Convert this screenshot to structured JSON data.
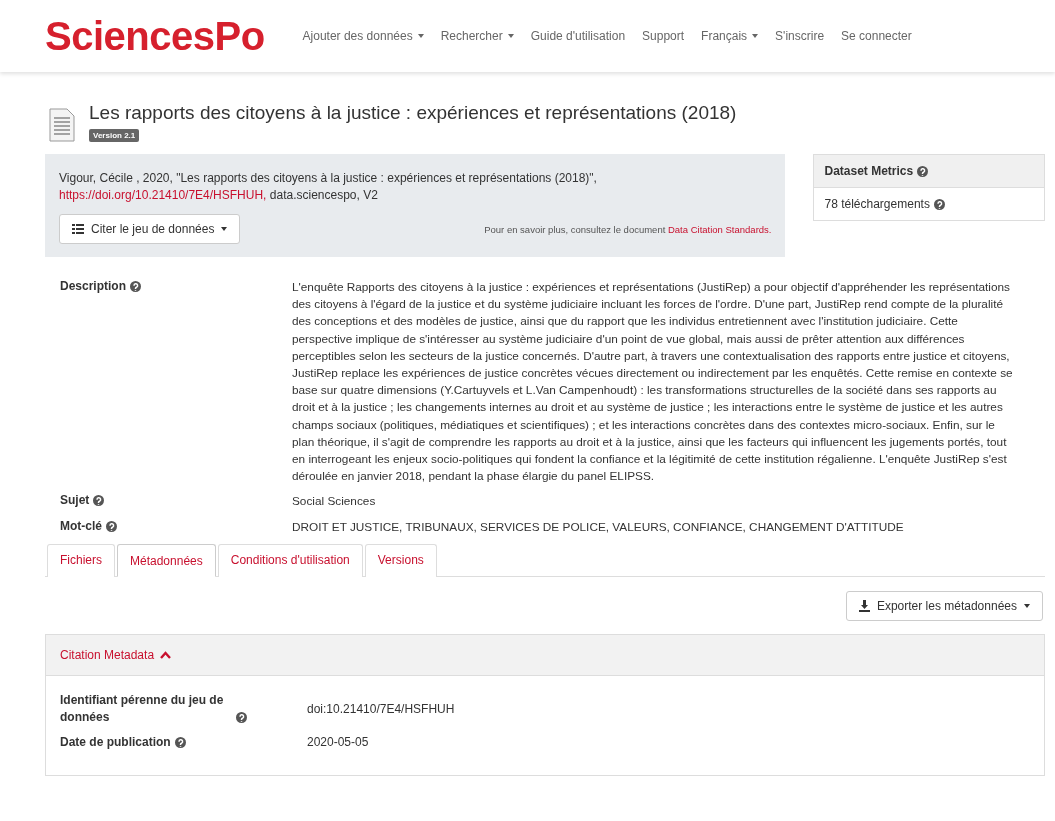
{
  "logo": "SciencesPo",
  "nav": [
    {
      "label": "Ajouter des données",
      "dropdown": true
    },
    {
      "label": "Rechercher",
      "dropdown": true
    },
    {
      "label": "Guide d'utilisation",
      "dropdown": false
    },
    {
      "label": "Support",
      "dropdown": false
    },
    {
      "label": "Français",
      "dropdown": true
    },
    {
      "label": "S'inscrire",
      "dropdown": false
    },
    {
      "label": "Se connecter",
      "dropdown": false
    }
  ],
  "dataset": {
    "title": "Les rapports des citoyens à la justice : expériences et représentations (2018)",
    "version": "Version 2.1"
  },
  "citation": {
    "text": "Vigour, Cécile , 2020, \"Les rapports des citoyens à la justice : expériences et représentations (2018)\",",
    "doi_link": "https://doi.org/10.21410/7E4/HSFHUH,",
    "suffix": "data.sciencespo, V2",
    "cite_button": "Citer le jeu de données",
    "note": "Pour en savoir plus, consultez le document",
    "note_link": "Data Citation Standards."
  },
  "metrics": {
    "title": "Dataset Metrics",
    "downloads": "78 téléchargements"
  },
  "fields": [
    {
      "label": "Description",
      "value": "L'enquête Rapports des citoyens à la justice : expériences et représentations (JustiRep) a pour objectif d'appréhender les représentations des citoyens à l'égard de la justice et du système judiciaire incluant les forces de l'ordre. D'une part, JustiRep rend compte de la pluralité des conceptions et des modèles de justice, ainsi que du rapport que les individus entretiennent avec l'institution judiciaire. Cette perspective implique de s'intéresser au système judiciaire d'un point de vue global, mais aussi de prêter attention aux différences perceptibles selon les secteurs de la justice concernés. D'autre part, à travers une contextualisation des rapports entre justice et citoyens, JustiRep replace les expériences de justice concrètes vécues directement ou indirectement par les enquêtés. Cette remise en contexte se base sur quatre dimensions (Y.Cartuyvels et L.Van Campenhoudt) : les transformations structurelles de la société dans ses rapports au droit et à la justice ; les changements internes au droit et au système de justice ; les interactions entre le système de justice et les autres champs sociaux (politiques, médiatiques et scientifiques) ; et les interactions concrètes dans des contextes micro-sociaux. Enfin, sur le plan théorique, il s'agit de comprendre les rapports au droit et à la justice, ainsi que les facteurs qui influencent les jugements portés, tout en interrogeant les enjeux socio-politiques qui fondent la confiance et la légitimité de cette institution régalienne. L'enquête JustiRep s'est déroulée en janvier 2018, pendant la phase élargie du panel ELIPSS."
    },
    {
      "label": "Sujet",
      "value": "Social Sciences"
    },
    {
      "label": "Mot-clé",
      "value": "DROIT ET JUSTICE, TRIBUNAUX, SERVICES DE POLICE, VALEURS, CONFIANCE, CHANGEMENT D'ATTITUDE"
    }
  ],
  "tabs": [
    {
      "label": "Fichiers",
      "selected": false
    },
    {
      "label": "Métadonnées",
      "selected": true
    },
    {
      "label": "Conditions d'utilisation",
      "selected": false
    },
    {
      "label": "Versions",
      "selected": false
    }
  ],
  "export_button": "Exporter les métadonnées",
  "section": {
    "title": "Citation Metadata",
    "expanded": true,
    "rows": [
      {
        "label": "Identifiant pérenne du jeu de données",
        "value": "doi:10.21410/7E4/HSFHUH"
      },
      {
        "label": "Date de publication",
        "value": "2020-05-05"
      }
    ]
  }
}
